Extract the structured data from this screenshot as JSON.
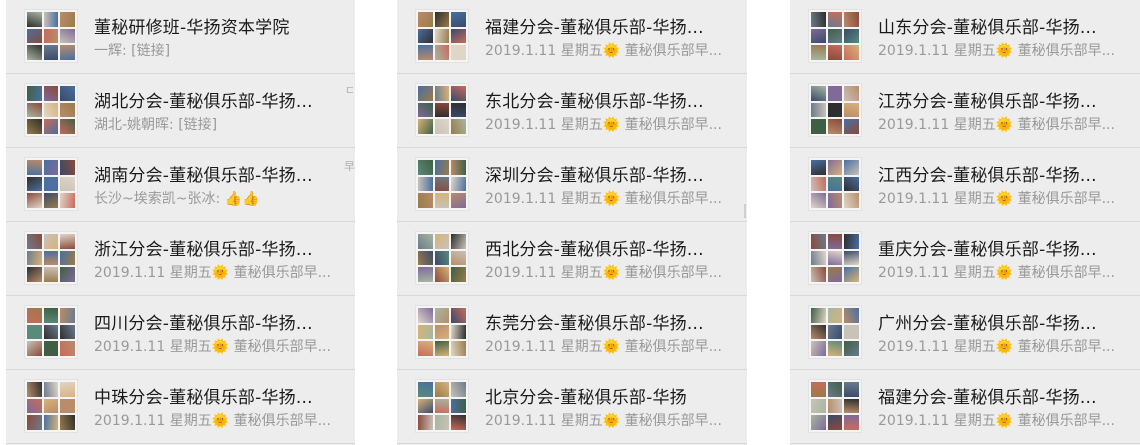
{
  "colors": {
    "list_bg": "#ededed",
    "row_divider": "#d9d9d9",
    "title": "#1a1a1a",
    "preview": "#999999"
  },
  "columns": [
    {
      "rows": [
        {
          "title": "董秘研修班-华扬资本学院",
          "preview": "一辉: [链接]"
        },
        {
          "title": "湖北分会-董秘俱乐部-华扬...",
          "preview": "湖北-姚朝晖: [链接]"
        },
        {
          "title": "湖南分会-董秘俱乐部-华扬...",
          "preview": "长沙~埃索凯~张冰: 👍👍"
        },
        {
          "title": "浙江分会-董秘俱乐部-华扬...",
          "preview": "2019.1.11 星期五🌞  董秘俱乐部早..."
        },
        {
          "title": "四川分会-董秘俱乐部-华扬...",
          "preview": "2019.1.11 星期五🌞  董秘俱乐部早..."
        },
        {
          "title": "中珠分会-董秘俱乐部-华扬...",
          "preview": "2019.1.11 星期五🌞  董秘俱乐部早..."
        }
      ],
      "edge_glyphs": [
        "ㄷ",
        "早"
      ]
    },
    {
      "rows": [
        {
          "title": "福建分会-董秘俱乐部-华扬...",
          "preview": "2019.1.11 星期五🌞  董秘俱乐部早..."
        },
        {
          "title": "东北分会-董秘俱乐部-华扬...",
          "preview": "2019.1.11 星期五🌞  董秘俱乐部早..."
        },
        {
          "title": "深圳分会-董秘俱乐部-华扬...",
          "preview": "2019.1.11 星期五🌞  董秘俱乐部早..."
        },
        {
          "title": "西北分会-董秘俱乐部-华扬...",
          "preview": "2019.1.11 星期五🌞  董秘俱乐部早..."
        },
        {
          "title": "东莞分会-董秘俱乐部-华扬...",
          "preview": "2019.1.11 星期五🌞  董秘俱乐部早..."
        },
        {
          "title": "北京分会-董秘俱乐部-华扬",
          "preview": "2019.1.11 星期五🌞  董秘俱乐部早..."
        }
      ]
    },
    {
      "rows": [
        {
          "title": "山东分会-董秘俱乐部-华扬...",
          "preview": "2019.1.11 星期五🌞  董秘俱乐部早..."
        },
        {
          "title": "江苏分会-董秘俱乐部-华扬...",
          "preview": "2019.1.11 星期五🌞  董秘俱乐部早..."
        },
        {
          "title": "江西分会-董秘俱乐部-华扬...",
          "preview": "2019.1.11 星期五🌞  董秘俱乐部早..."
        },
        {
          "title": "重庆分会-董秘俱乐部-华扬...",
          "preview": "2019.1.11 星期五🌞  董秘俱乐部早..."
        },
        {
          "title": "广州分会-董秘俱乐部-华扬...",
          "preview": "2019.1.11 星期五🌞  董秘俱乐部早..."
        },
        {
          "title": "福建分会-董秘俱乐部-华扬...",
          "preview": "2019.1.11 星期五🌞  董秘俱乐部早..."
        }
      ]
    }
  ]
}
